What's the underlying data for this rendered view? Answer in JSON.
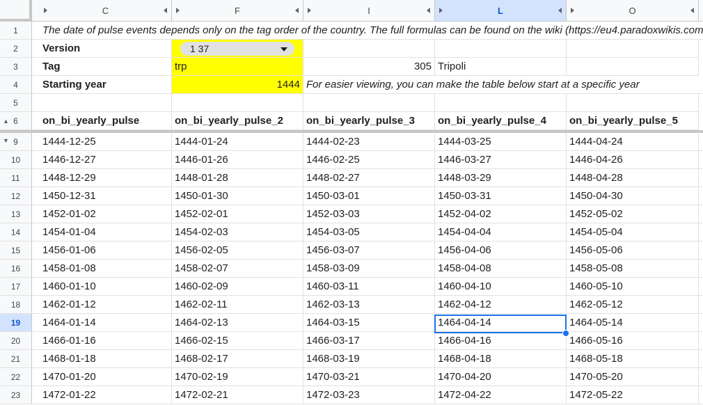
{
  "columns": [
    {
      "letter": "C"
    },
    {
      "letter": "F"
    },
    {
      "letter": "I"
    },
    {
      "letter": "L"
    },
    {
      "letter": "O"
    }
  ],
  "info": {
    "row1_num": "1",
    "description": "The date of pulse events depends only on the tag order of the country. The full formulas can be found on the wiki (https://eu4.paradoxwikis.com/...",
    "row2_num": "2",
    "version_label": "Version",
    "version_value": "1 37",
    "row3_num": "3",
    "tag_label": "Tag",
    "tag_value": "trp",
    "tag_number": "305",
    "tag_name": "Tripoli",
    "row4_num": "4",
    "starting_year_label": "Starting year",
    "starting_year_value": "1444",
    "starting_year_note": "For easier viewing, you can make the table below start at a specific year",
    "row5_num": "5",
    "row6_num": "6"
  },
  "headers": [
    "on_bi_yearly_pulse",
    "on_bi_yearly_pulse_2",
    "on_bi_yearly_pulse_3",
    "on_bi_yearly_pulse_4",
    "on_bi_yearly_pulse_5"
  ],
  "rows": [
    {
      "num": "9",
      "cells": [
        "1444-12-25",
        "1444-01-24",
        "1444-02-23",
        "1444-03-25",
        "1444-04-24"
      ]
    },
    {
      "num": "10",
      "cells": [
        "1446-12-27",
        "1446-01-26",
        "1446-02-25",
        "1446-03-27",
        "1446-04-26"
      ]
    },
    {
      "num": "11",
      "cells": [
        "1448-12-29",
        "1448-01-28",
        "1448-02-27",
        "1448-03-29",
        "1448-04-28"
      ]
    },
    {
      "num": "12",
      "cells": [
        "1450-12-31",
        "1450-01-30",
        "1450-03-01",
        "1450-03-31",
        "1450-04-30"
      ]
    },
    {
      "num": "13",
      "cells": [
        "1452-01-02",
        "1452-02-01",
        "1452-03-03",
        "1452-04-02",
        "1452-05-02"
      ]
    },
    {
      "num": "14",
      "cells": [
        "1454-01-04",
        "1454-02-03",
        "1454-03-05",
        "1454-04-04",
        "1454-05-04"
      ]
    },
    {
      "num": "15",
      "cells": [
        "1456-01-06",
        "1456-02-05",
        "1456-03-07",
        "1456-04-06",
        "1456-05-06"
      ]
    },
    {
      "num": "16",
      "cells": [
        "1458-01-08",
        "1458-02-07",
        "1458-03-09",
        "1458-04-08",
        "1458-05-08"
      ]
    },
    {
      "num": "17",
      "cells": [
        "1460-01-10",
        "1460-02-09",
        "1460-03-11",
        "1460-04-10",
        "1460-05-10"
      ]
    },
    {
      "num": "18",
      "cells": [
        "1462-01-12",
        "1462-02-11",
        "1462-03-13",
        "1462-04-12",
        "1462-05-12"
      ]
    },
    {
      "num": "19",
      "cells": [
        "1464-01-14",
        "1464-02-13",
        "1464-03-15",
        "1464-04-14",
        "1464-05-14"
      ]
    },
    {
      "num": "20",
      "cells": [
        "1466-01-16",
        "1466-02-15",
        "1466-03-17",
        "1466-04-16",
        "1466-05-16"
      ]
    },
    {
      "num": "21",
      "cells": [
        "1468-01-18",
        "1468-02-17",
        "1468-03-19",
        "1468-04-18",
        "1468-05-18"
      ]
    },
    {
      "num": "22",
      "cells": [
        "1470-01-20",
        "1470-02-19",
        "1470-03-21",
        "1470-04-20",
        "1470-05-20"
      ]
    },
    {
      "num": "23",
      "cells": [
        "1472-01-22",
        "1472-02-21",
        "1472-03-23",
        "1472-04-22",
        "1472-05-22"
      ]
    }
  ],
  "selection": {
    "active_row": "19",
    "active_col": "L"
  },
  "colors": {
    "accent": "#1a73e8",
    "highlight": "#ffff00",
    "active_header": "#d3e3fd"
  }
}
